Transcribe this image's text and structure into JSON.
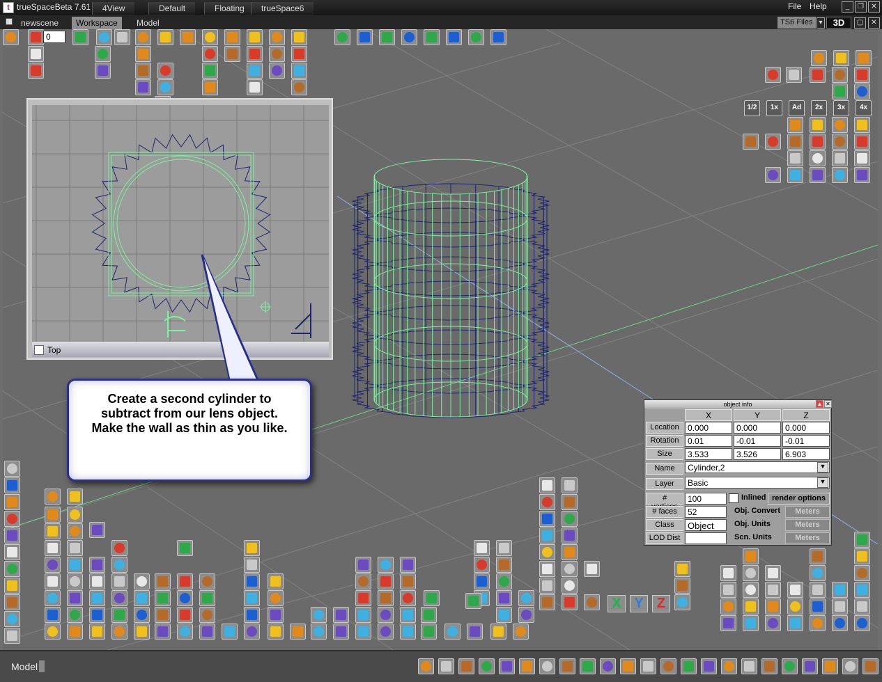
{
  "window": {
    "title": "trueSpaceBeta 7.61",
    "view_tabs": [
      "4View",
      "Default",
      "Floating",
      "trueSpace6"
    ],
    "menu": [
      "File",
      "Help"
    ]
  },
  "tabs": {
    "scene": "newscene",
    "items": [
      "Workspace",
      "Model"
    ],
    "active": "Workspace"
  },
  "library": {
    "label": "TS6 Files",
    "mode_button": "3D"
  },
  "frame_field": "0",
  "top_view": {
    "label": "Top"
  },
  "callout": {
    "lines": [
      "Create a second cylinder to",
      "subtract from our lens object.",
      "Make the wall as thin as you like."
    ]
  },
  "render_quality_labels": [
    "1/2",
    "1x",
    "Ad",
    "2x",
    "3x",
    "4x"
  ],
  "object_info": {
    "title": "object info",
    "axes": [
      "X",
      "Y",
      "Z"
    ],
    "rows": [
      {
        "label": "Location",
        "values": [
          "0.000",
          "0.000",
          "0.000"
        ]
      },
      {
        "label": "Rotation",
        "values": [
          "0.01",
          "-0.01",
          "-0.01"
        ]
      },
      {
        "label": "Size",
        "values": [
          "3.533",
          "3.526",
          "6.903"
        ]
      }
    ],
    "name_label": "Name",
    "name_value": "Cylinder,2",
    "layer_label": "Layer",
    "layer_value": "Basic",
    "vertices_label": "# vertices",
    "vertices_value": "100",
    "faces_label": "# faces",
    "faces_value": "52",
    "class_label": "Class",
    "class_value": "Object",
    "lod_label": "LOD Dist",
    "lod_value": "",
    "inlined_label": "Inlined",
    "render_options": "render options",
    "obj_convert": "Obj. Convert",
    "obj_units": "Obj. Units",
    "scn_units": "Scn. Units",
    "meters": "Meters"
  },
  "axis_letters": [
    "X",
    "Y",
    "Z"
  ],
  "status": {
    "mode": "Model"
  },
  "colors": {
    "wire_green": "#7ef0a0",
    "wire_navy": "#1e2470",
    "callout_border": "#2a2f8e",
    "viewport_bg": "#6a6a6a"
  }
}
